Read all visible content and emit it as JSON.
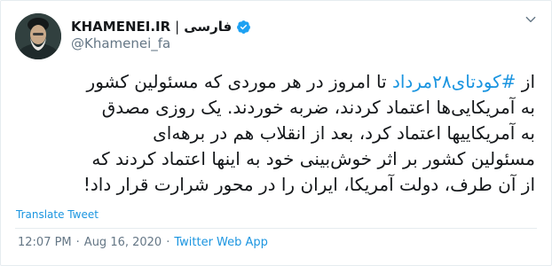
{
  "author": {
    "display_name": "KHAMENEI.IR",
    "separator": "|",
    "language": "فارسی",
    "handle": "@Khamenei_fa"
  },
  "tweet": {
    "line1_prefix": "از ",
    "hashtag": "#کودتای۲۸مرداد",
    "line1_suffix": " تا امروز در هر موردی که مسئولین کشور",
    "line2": "به آمریکایی‌ها اعتماد کردند، ضربه خوردند. یک روزی مصدق",
    "line3": "به آمریکاییها اعتماد کرد، بعد از انقلاب هم در برهه‌ای",
    "line4": "مسئولین کشور بر اثر خوش‌بینی خود به اینها اعتماد کردند که",
    "line5": "از آن طرف، دولت آمریکا، ایران را در محور شرارت قرار داد!"
  },
  "translate_label": "Translate Tweet",
  "meta": {
    "time": "12:07 PM",
    "dot1": "·",
    "date": "Aug 16, 2020",
    "dot2": "·",
    "source": "Twitter Web App"
  },
  "colors": {
    "link": "#1b95e0",
    "secondary_text": "#657786",
    "verified": "#1da1f2"
  },
  "icons": {
    "verified": "verified-badge-icon",
    "menu": "chevron-down-icon"
  }
}
